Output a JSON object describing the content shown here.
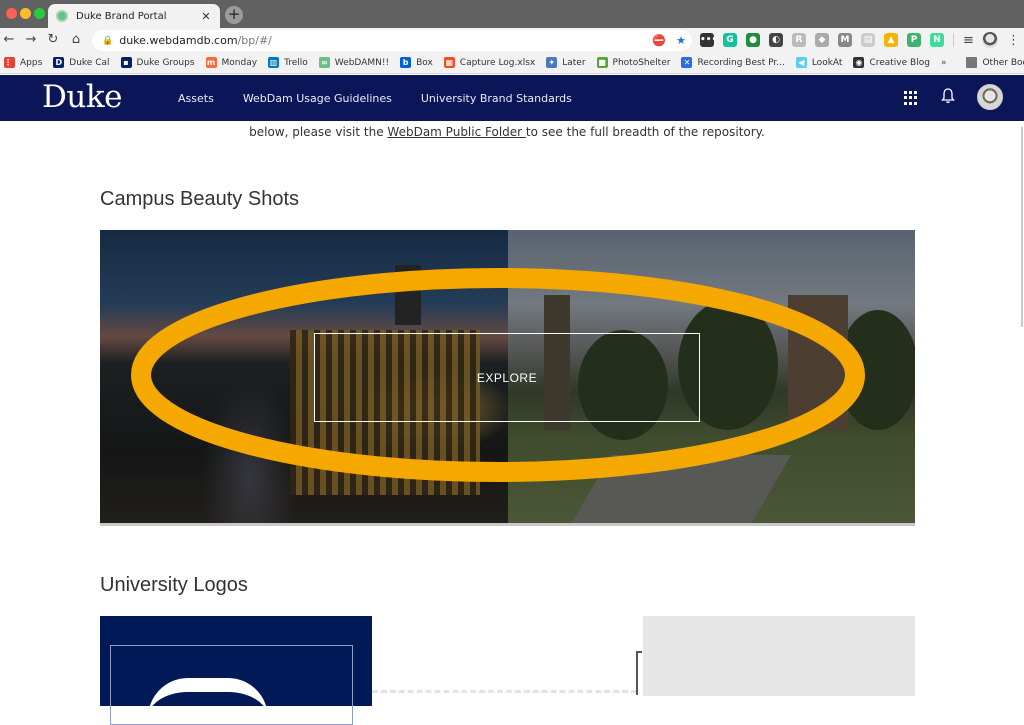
{
  "browser": {
    "tab_title": "Duke Brand Portal",
    "tab_close": "✕",
    "new_tab": "+",
    "url_host": "duke.webdamdb.com",
    "url_path": "/bp/#/",
    "nav": {
      "back": "←",
      "forward": "→",
      "reload": "↻",
      "home": "⌂"
    },
    "extensions": [
      {
        "name": "more-ext",
        "glyph": "•••",
        "color": "#333333"
      },
      {
        "name": "grammarly-ext",
        "glyph": "G",
        "color": "#15c39a"
      },
      {
        "name": "hangouts-ext",
        "glyph": "●",
        "color": "#1e8e3e"
      },
      {
        "name": "circle-ext",
        "glyph": "◐",
        "color": "#444444"
      },
      {
        "name": "reader-ext",
        "glyph": "R",
        "color": "#bbbbbb"
      },
      {
        "name": "dropbox-ext",
        "glyph": "◆",
        "color": "#aaaaaa"
      },
      {
        "name": "m-ext",
        "glyph": "M",
        "color": "#888888"
      },
      {
        "name": "doc-ext",
        "glyph": "▤",
        "color": "#cccccc"
      },
      {
        "name": "drive-ext",
        "glyph": "▲",
        "color": "#f4b400"
      },
      {
        "name": "p-ext",
        "glyph": "P",
        "color": "#3cb371"
      },
      {
        "name": "n-ext",
        "glyph": "N",
        "color": "#3ddc97"
      }
    ],
    "bookmarks": [
      {
        "label": "Apps",
        "icon": "apps-icon",
        "glyph": "⋮⋮",
        "color": "#e94235"
      },
      {
        "label": "Duke Cal",
        "icon": "duke-cal-icon",
        "glyph": "D",
        "color": "#012169"
      },
      {
        "label": "Duke Groups",
        "icon": "duke-groups-icon",
        "glyph": "▪",
        "color": "#012169"
      },
      {
        "label": "Monday",
        "icon": "monday-icon",
        "glyph": "m",
        "color": "#ff6a3d"
      },
      {
        "label": "Trello",
        "icon": "trello-icon",
        "glyph": "▥",
        "color": "#0079bf"
      },
      {
        "label": "WebDAMN!!",
        "icon": "webdam-icon",
        "glyph": "∞",
        "color": "#6bbf86"
      },
      {
        "label": "Box",
        "icon": "box-icon",
        "glyph": "b",
        "color": "#0061d5"
      },
      {
        "label": "Capture Log.xlsx",
        "icon": "microsoft-icon",
        "glyph": "▦",
        "color": "#f25022"
      },
      {
        "label": "Later",
        "icon": "later-icon",
        "glyph": "✦",
        "color": "#4b7bbd"
      },
      {
        "label": "PhotoShelter",
        "icon": "photoshelter-icon",
        "glyph": "■",
        "color": "#55a630"
      },
      {
        "label": "Recording Best Pr...",
        "icon": "recording-icon",
        "glyph": "✕",
        "color": "#2d6cdf"
      },
      {
        "label": "LookAt",
        "icon": "lookat-icon",
        "glyph": "◀",
        "color": "#5ad1e8"
      },
      {
        "label": "Creative Blog",
        "icon": "globe-icon",
        "glyph": "◉",
        "color": "#333333"
      }
    ],
    "bookmarks_more": "»",
    "other_bookmarks": "Other Bookmarks"
  },
  "header": {
    "logo": "Duke",
    "nav": [
      "Assets",
      "WebDam Usage Guidelines",
      "University Brand Standards"
    ],
    "bell": "🔔"
  },
  "content": {
    "intro_prefix": "below, please visit the ",
    "intro_link": "WebDam Public Folder ",
    "intro_suffix": "to see the full breadth of the repository.",
    "sections": [
      {
        "title": "Campus Beauty Shots",
        "cta": "EXPLORE"
      },
      {
        "title": "University Logos"
      }
    ],
    "annotation_color": "#f5a800"
  }
}
